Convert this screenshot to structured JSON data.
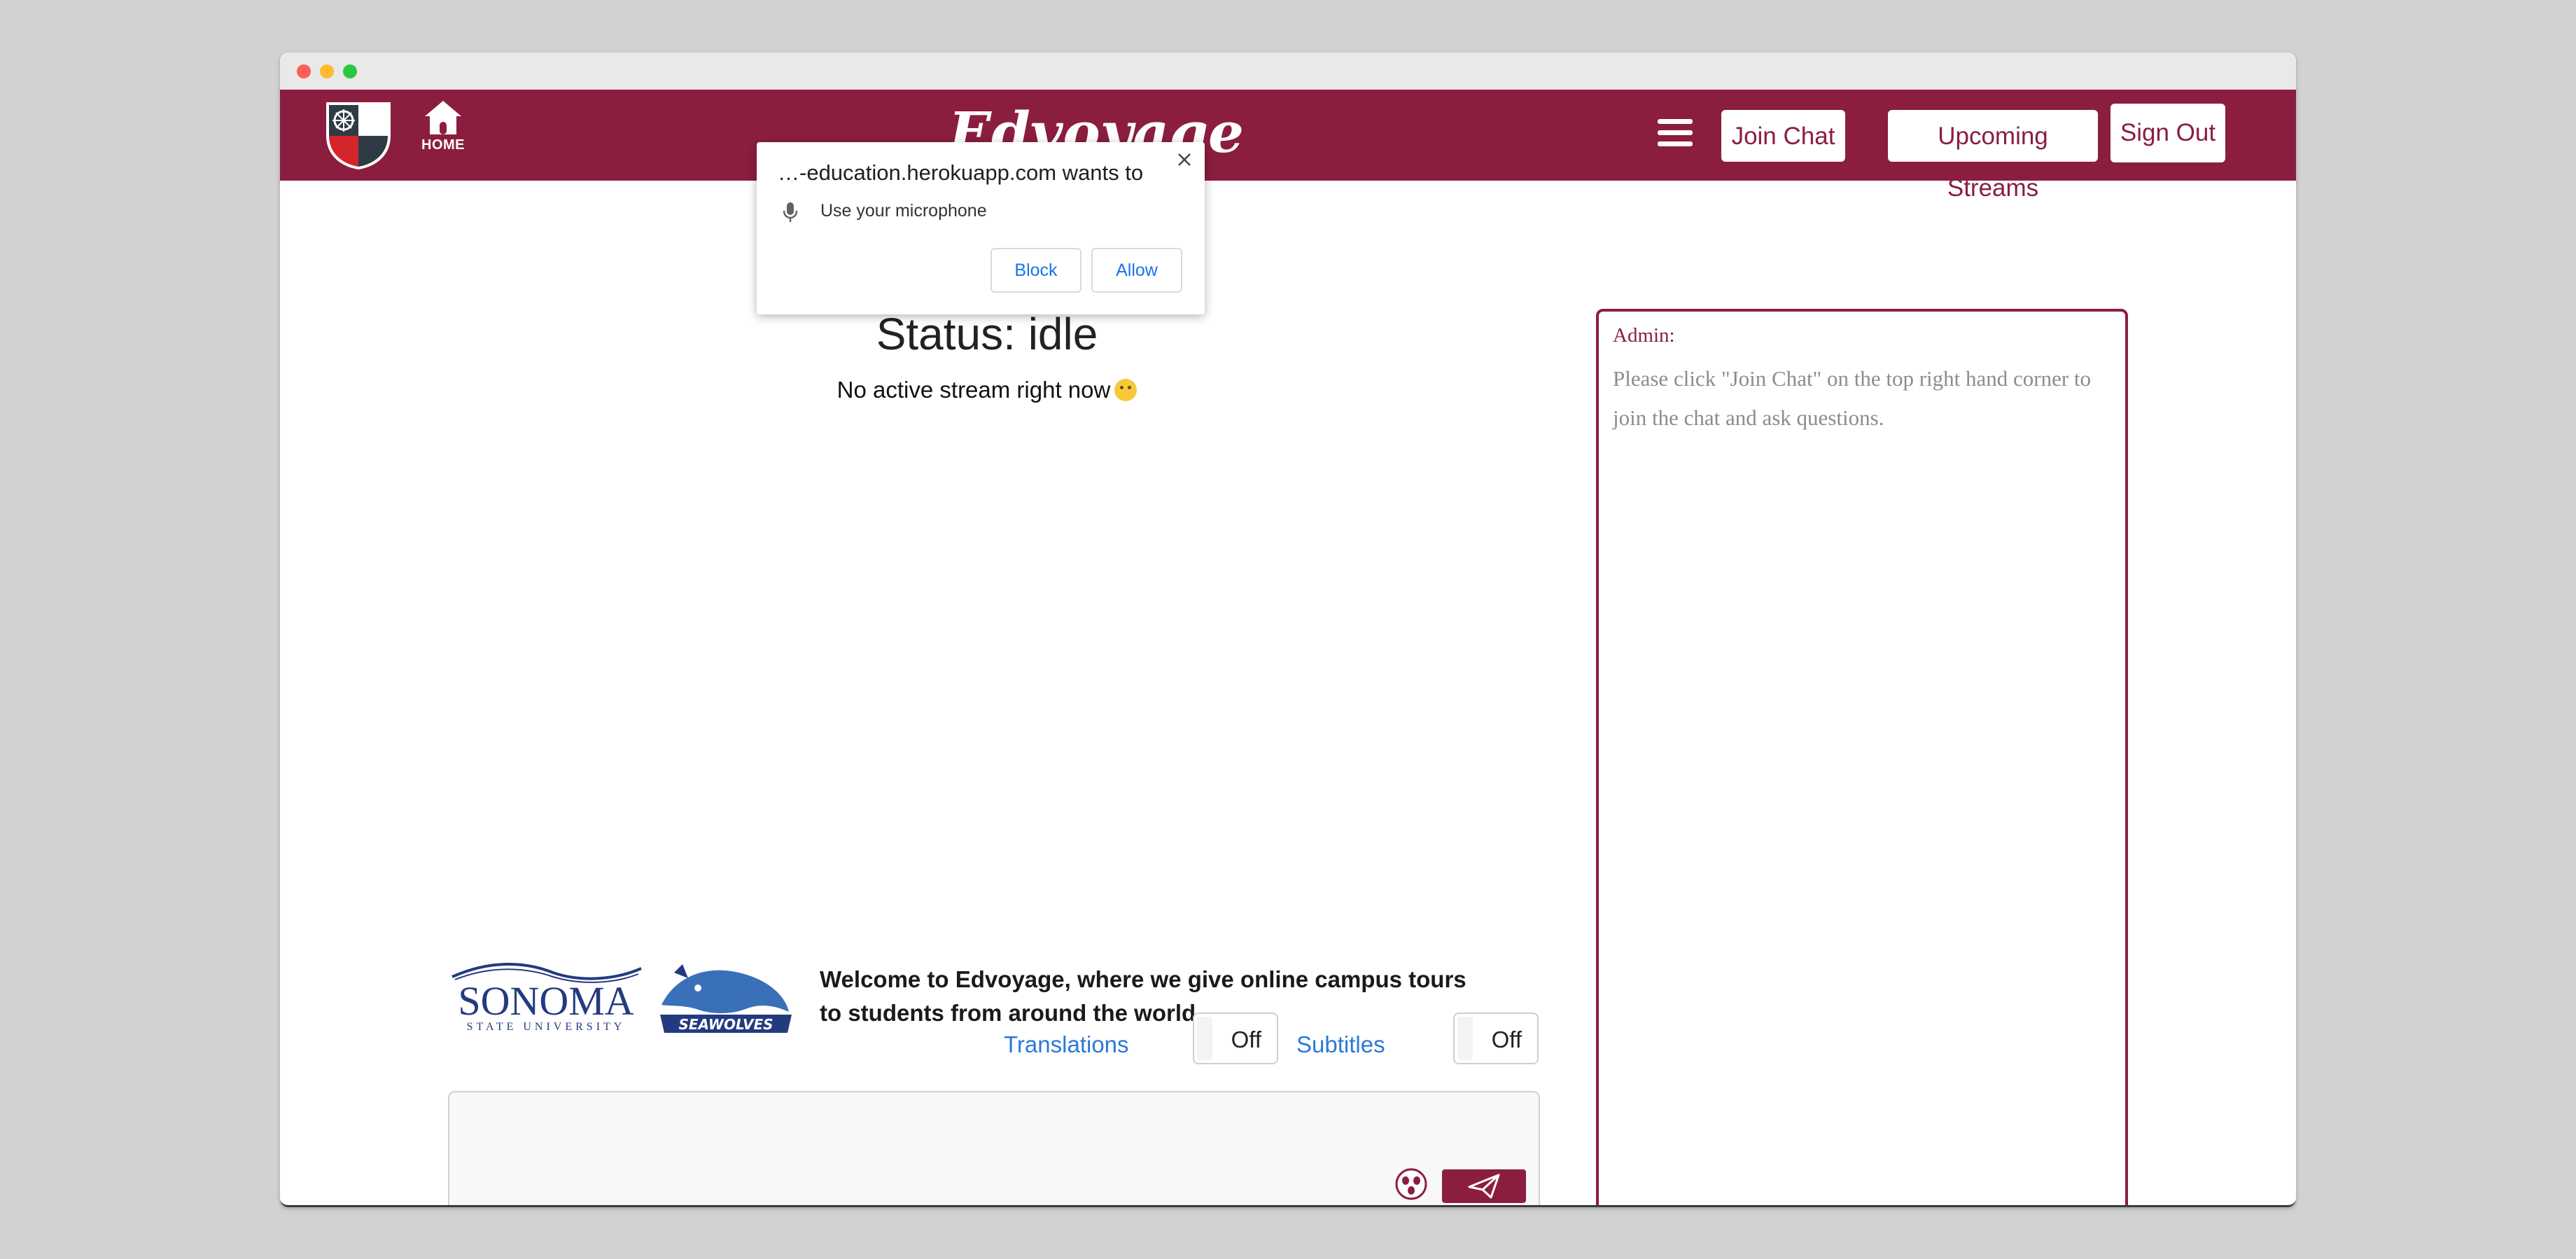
{
  "navbar": {
    "home_label": "HOME",
    "brand": "Edvoyage",
    "join_chat": "Join Chat",
    "upcoming_streams": "Upcoming Streams",
    "sign_out": "Sign Out",
    "color": "#8b1e3f"
  },
  "permission_popup": {
    "title": "…-education.herokuapp.com wants to",
    "permission": "Use your microphone",
    "block": "Block",
    "allow": "Allow"
  },
  "stream": {
    "status": "Status: idle",
    "message": "No active stream right now"
  },
  "info": {
    "sonoma_name": "SONOMA",
    "sonoma_sub": "STATE UNIVERSITY",
    "seawolves": "SEAWOLVES",
    "welcome": "Welcome to Edvoyage, where we give online campus tours to students from around the world.",
    "translations_label": "Translations",
    "translations_state": "Off",
    "subtitles_label": "Subtitles",
    "subtitles_state": "Off"
  },
  "chat": {
    "admin_label": "Admin:",
    "admin_message": "Please click \"Join Chat\" on the top right hand corner to join the chat and ask questions."
  },
  "icons": {
    "crest": "crest-logo-icon",
    "home": "home-icon",
    "menu": "hamburger-menu-icon",
    "mic": "microphone-icon",
    "close": "close-icon",
    "emoji": "emoji-icon",
    "send": "send-icon"
  }
}
